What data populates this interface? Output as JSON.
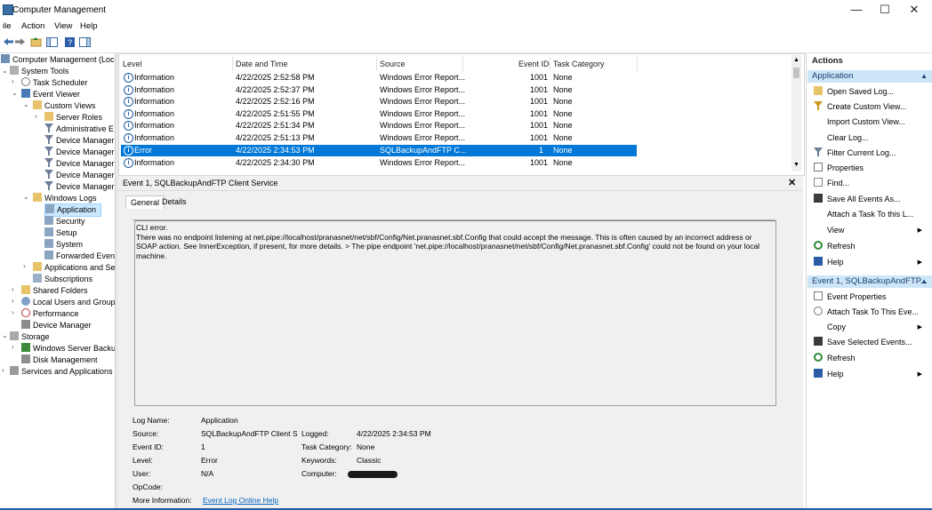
{
  "window": {
    "title": "Computer Management",
    "minimize": "—",
    "maximize": "☐",
    "close": "✕"
  },
  "menu": [
    "ile",
    "Action",
    "View",
    "Help"
  ],
  "tree": {
    "root": "Computer Management (Local",
    "system_tools": "System Tools",
    "task_scheduler": "Task Scheduler",
    "event_viewer": "Event Viewer",
    "custom_views": "Custom Views",
    "server_roles": "Server Roles",
    "administrative": "Administrative E",
    "device_manager_1": "Device Manager",
    "device_manager_2": "Device Manager",
    "device_manager_3": "Device Manager",
    "device_manager_4": "Device Manager",
    "device_manager_5": "Device Manager",
    "windows_logs": "Windows Logs",
    "application": "Application",
    "security": "Security",
    "setup": "Setup",
    "system": "System",
    "forwarded": "Forwarded Event",
    "apps_services": "Applications and Se",
    "subscriptions": "Subscriptions",
    "shared_folders": "Shared Folders",
    "local_users": "Local Users and Groups",
    "performance": "Performance",
    "device_manager": "Device Manager",
    "storage": "Storage",
    "wsb": "Windows Server Backup",
    "disk_mgmt": "Disk Management",
    "services_apps": "Services and Applications"
  },
  "events": {
    "columns": {
      "level": "Level",
      "datetime": "Date and Time",
      "source": "Source",
      "event_id": "Event ID",
      "task_category": "Task Category"
    },
    "rows": [
      {
        "level": "Information",
        "datetime": "4/22/2025 2:52:58 PM",
        "source": "Windows Error Report...",
        "event_id": "1001",
        "task_category": "None"
      },
      {
        "level": "Information",
        "datetime": "4/22/2025 2:52:37 PM",
        "source": "Windows Error Report...",
        "event_id": "1001",
        "task_category": "None"
      },
      {
        "level": "Information",
        "datetime": "4/22/2025 2:52:16 PM",
        "source": "Windows Error Report...",
        "event_id": "1001",
        "task_category": "None"
      },
      {
        "level": "Information",
        "datetime": "4/22/2025 2:51:55 PM",
        "source": "Windows Error Report...",
        "event_id": "1001",
        "task_category": "None"
      },
      {
        "level": "Information",
        "datetime": "4/22/2025 2:51:34 PM",
        "source": "Windows Error Report...",
        "event_id": "1001",
        "task_category": "None"
      },
      {
        "level": "Information",
        "datetime": "4/22/2025 2:51:13 PM",
        "source": "Windows Error Report...",
        "event_id": "1001",
        "task_category": "None"
      },
      {
        "level": "Error",
        "datetime": "4/22/2025 2:34:53 PM",
        "source": "SQLBackupAndFTP C...",
        "event_id": "1",
        "task_category": "None"
      },
      {
        "level": "Information",
        "datetime": "4/22/2025 2:34:30 PM",
        "source": "Windows Error Report...",
        "event_id": "1001",
        "task_category": "None"
      }
    ]
  },
  "detail": {
    "header": "Event 1, SQLBackupAndFTP Client Service",
    "close": "✕",
    "tabs": {
      "general": "General",
      "details": "Details"
    },
    "message_line1": "CLI error.",
    "message_line2": "There was no endpoint listening at net.pipe://localhost/pranasnet/net/sbf/Config/Net.pranasnet.sbf.Config that could accept the message. This is often caused by an incorrect address or SOAP action. See InnerException, if present, for more details. > The pipe endpoint 'net.pipe://localhost/pranasnet/net/sbf/Config/Net.pranasnet.sbf.Config' could not be found on your local machine.",
    "fields": {
      "log_name_label": "Log Name:",
      "log_name": "Application",
      "source_label": "Source:",
      "source": "SQLBackupAndFTP Client Se",
      "logged_label": "Logged:",
      "logged": "4/22/2025 2:34:53 PM",
      "event_id_label": "Event ID:",
      "event_id": "1",
      "task_category_label": "Task Category:",
      "task_category": "None",
      "level_label": "Level:",
      "level": "Error",
      "keywords_label": "Keywords:",
      "keywords": "Classic",
      "user_label": "User:",
      "user": "N/A",
      "computer_label": "Computer:",
      "opcode_label": "OpCode:",
      "more_info_label": "More Information:",
      "more_info_link": "Event Log Online Help"
    }
  },
  "actions": {
    "title": "Actions",
    "section1": "Application",
    "items1": [
      "Open Saved Log...",
      "Create Custom View...",
      "Import Custom View...",
      "Clear Log...",
      "Filter Current Log...",
      "Properties",
      "Find...",
      "Save All Events As...",
      "Attach a Task To this L...",
      "View",
      "Refresh",
      "Help"
    ],
    "section2": "Event 1, SQLBackupAndFTP...",
    "items2": [
      "Event Properties",
      "Attach Task To This Eve...",
      "Copy",
      "Save Selected Events...",
      "Refresh",
      "Help"
    ]
  },
  "colors": {
    "selection": "#0078d7",
    "link": "#0563c1",
    "header_band": "#cde6f7",
    "taskbar": "#1f5ba6"
  }
}
